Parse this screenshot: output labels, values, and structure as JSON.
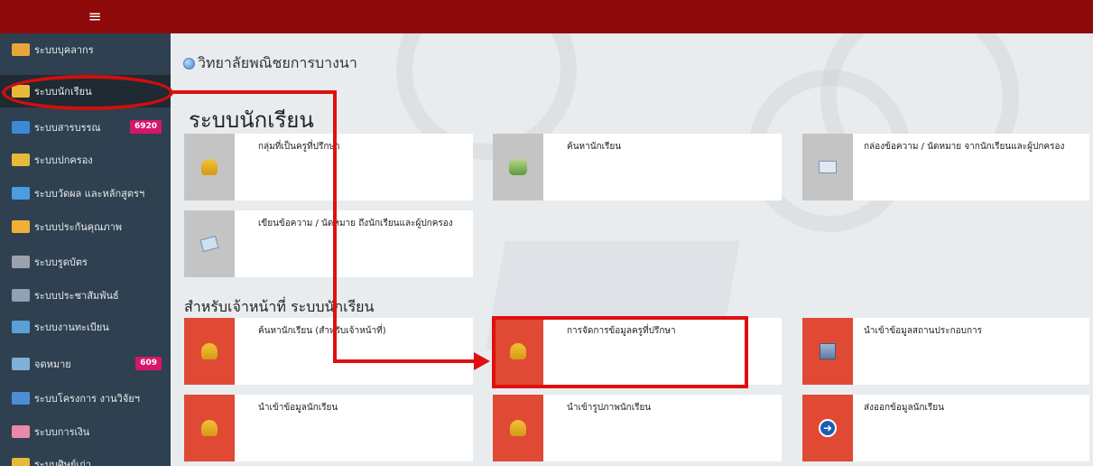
{
  "topbar": {
    "menu_icon": "≡"
  },
  "sidebar": {
    "items": [
      {
        "label": "ระบบบุคลากร",
        "icon": "people-icon",
        "color": "#e8a53a"
      },
      {
        "label": "ระบบนักเรียน",
        "icon": "student-icon",
        "color": "#e6b93c",
        "active": true
      },
      {
        "label": "ระบบสารบรรณ",
        "icon": "mail-icon",
        "color": "#3a8ad6",
        "badge": "6920"
      },
      {
        "label": "ระบบปกครอง",
        "icon": "guardian-icon",
        "color": "#e6b93c"
      },
      {
        "label": "ระบบวัดผล และหลักสูตรฯ",
        "icon": "chart-icon",
        "color": "#4a9de0"
      },
      {
        "label": "ระบบประกันคุณภาพ",
        "icon": "thumb-icon",
        "color": "#f0b038"
      },
      {
        "label": "ระบบรูดบัตร",
        "icon": "calendar-icon",
        "color": "#9aa3ad"
      },
      {
        "label": "ระบบประชาสัมพันธ์",
        "icon": "document-icon",
        "color": "#8fa1b5"
      },
      {
        "label": "ระบบงานทะเบียน",
        "icon": "register-icon",
        "color": "#5aa0d8"
      },
      {
        "label": "จดหมาย",
        "icon": "letter-icon",
        "color": "#7fb0d8",
        "badge": "609"
      },
      {
        "label": "ระบบโครงการ งานวิจัยฯ",
        "icon": "project-icon",
        "color": "#4a8fd6"
      },
      {
        "label": "ระบบการเงิน",
        "icon": "finance-icon",
        "color": "#e88aa8"
      },
      {
        "label": "ระบบศิษย์เก่า",
        "icon": "alumni-icon",
        "color": "#e6b93c"
      }
    ]
  },
  "main": {
    "college_name": "วิทยาลัยพณิชยการบางนา",
    "section_title": "ระบบนักเรียน",
    "section2_title": "สำหรับเจ้าหน้าที่ ระบบนักเรียน",
    "cards": [
      {
        "label": "กลุ่มที่เป็นครูที่ปรึกษา",
        "icon": "advisor-group-icon",
        "style": "gray"
      },
      {
        "label": "ค้นหานักเรียน",
        "icon": "search-student-icon",
        "style": "gray"
      },
      {
        "label": "กล่องข้อความ / นัดหมาย จากนักเรียนและผู้ปกครอง",
        "icon": "inbox-icon",
        "style": "gray"
      },
      {
        "label": "เขียนข้อความ / นัดหมาย ถึงนักเรียนและผู้ปกครอง",
        "icon": "compose-icon",
        "style": "gray"
      }
    ],
    "staff_cards": [
      {
        "label": "ค้นหานักเรียน (สำหรับเจ้าหน้าที่)",
        "icon": "staff-search-icon"
      },
      {
        "label": "การจัดการข้อมูลครูที่ปรึกษา",
        "icon": "advisor-manage-icon"
      },
      {
        "label": "นำเข้าข้อมูลสถานประกอบการ",
        "icon": "import-company-icon"
      },
      {
        "label": "นำเข้าข้อมูลนักเรียน",
        "icon": "import-student-icon"
      },
      {
        "label": "นำเข้ารูปภาพนักเรียน",
        "icon": "import-photo-icon"
      },
      {
        "label": "ส่งออกข้อมูลนักเรียน",
        "icon": "export-student-icon"
      }
    ]
  },
  "colors": {
    "topbar": "#8f0a0a",
    "sidebar": "#2f4050",
    "annotation": "#e01010",
    "tile_red": "#e04a35",
    "tile_gray": "#c4c4c4"
  }
}
